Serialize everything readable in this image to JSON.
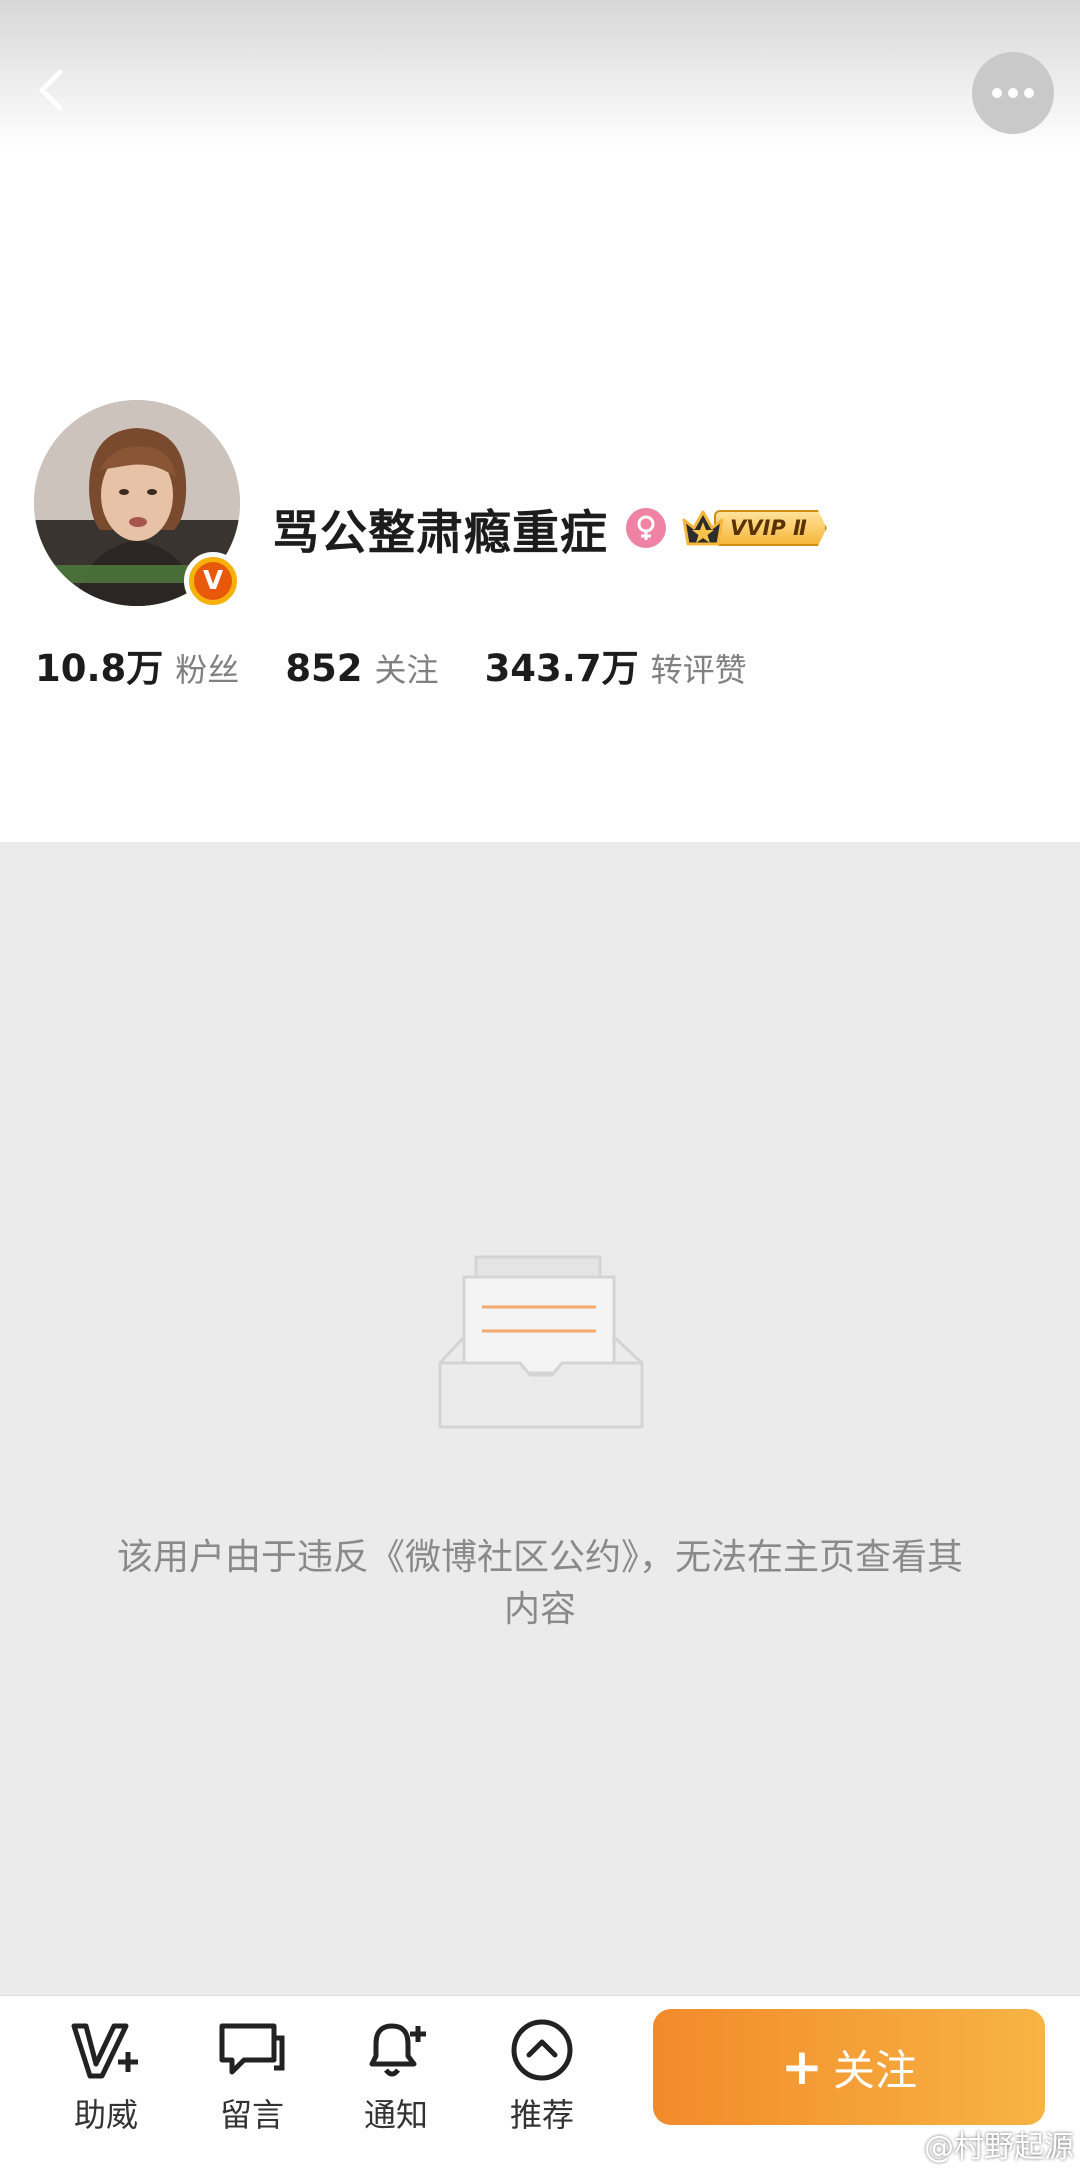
{
  "header": {
    "back_icon": "chevron-left-icon",
    "more_icon": "ellipsis-icon"
  },
  "profile": {
    "username": "骂公整肃瘾重症",
    "verified_badge": "V",
    "gender_icon": "female-icon",
    "vip_label": "VVIP Ⅱ",
    "stats": [
      {
        "value": "10.8万",
        "label": "粉丝"
      },
      {
        "value": "852",
        "label": "关注"
      },
      {
        "value": "343.7万",
        "label": "转评赞"
      }
    ]
  },
  "empty_state": {
    "icon": "empty-inbox-icon",
    "message": "该用户由于违反《微博社区公约》，无法在主页查看其内容"
  },
  "bottom_nav": {
    "items": [
      {
        "label": "助威",
        "icon": "v-plus-icon"
      },
      {
        "label": "留言",
        "icon": "message-icon"
      },
      {
        "label": "通知",
        "icon": "bell-plus-icon"
      },
      {
        "label": "推荐",
        "icon": "chevron-up-circle-icon"
      }
    ],
    "follow_button": {
      "plus": "+",
      "label": "关注"
    }
  },
  "watermark": "@村野起源",
  "colors": {
    "accent_orange": "#f28a2b",
    "vip_gold": "#f6b73c",
    "gender_pink": "#ee83a5"
  }
}
